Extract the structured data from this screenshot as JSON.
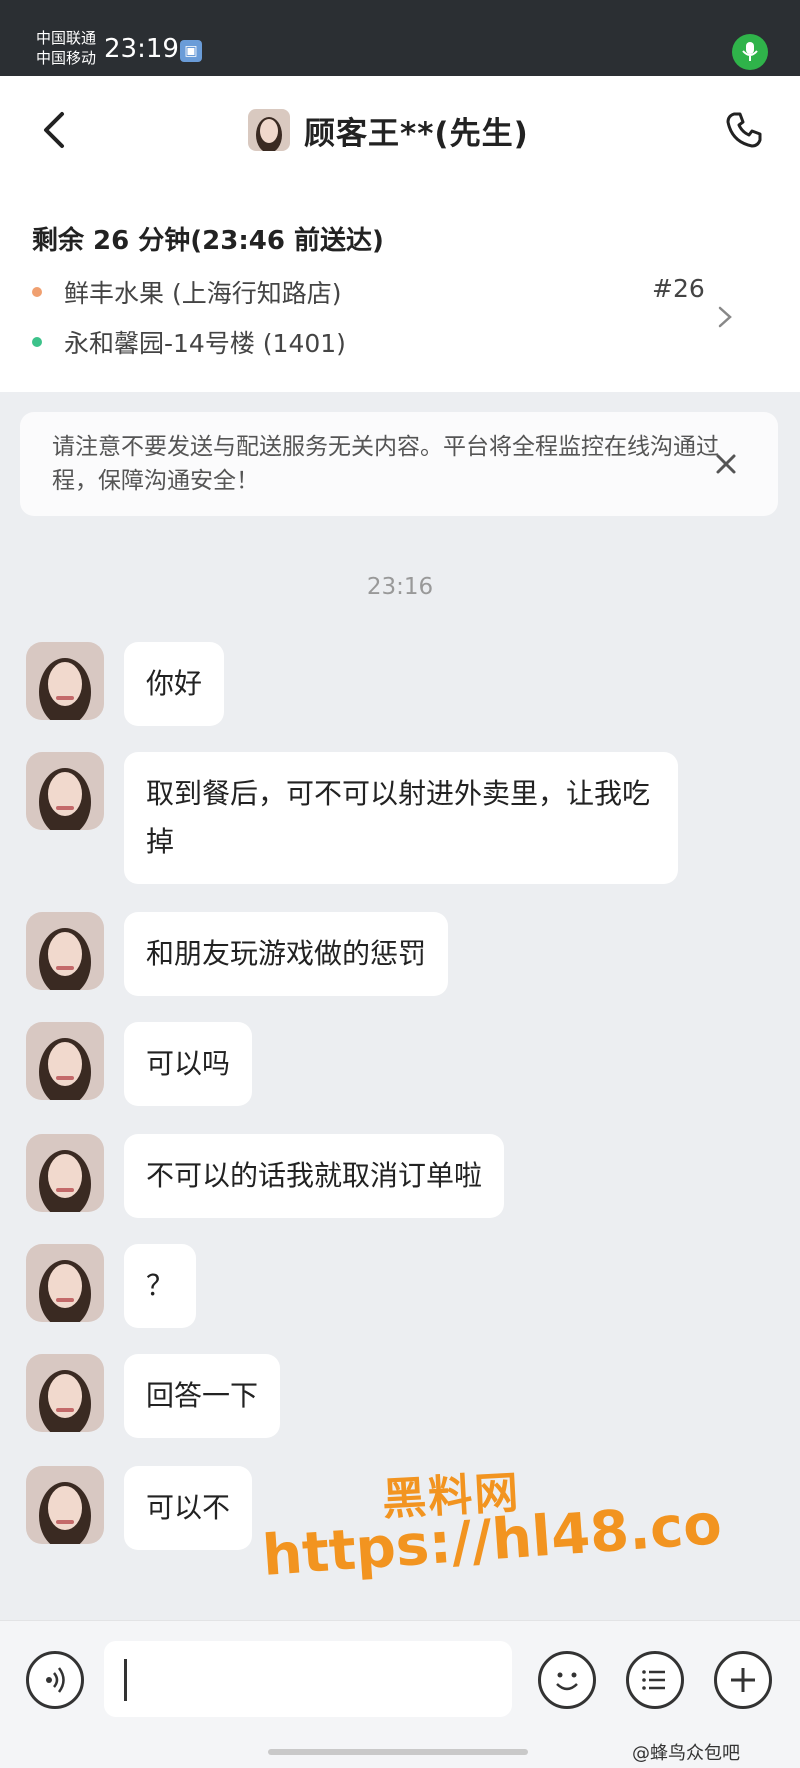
{
  "status_bar": {
    "carrier1": "中国联通",
    "carrier2": "中国移动",
    "time": "23:19",
    "sim_icon": "sim-icon",
    "mic_icon": "mic-icon"
  },
  "header": {
    "title": "顾客王**(先生)",
    "back_icon": "chevron-left-icon",
    "phone_icon": "phone-icon"
  },
  "order": {
    "remaining": "剩余 26 分钟(23:46 前送达)",
    "store": "鲜丰水果 (上海行知路店)",
    "address": "永和馨园-14号楼 (1401)",
    "order_number": "#26",
    "store_dot_color": "#f0a070",
    "address_dot_color": "#3cc28a"
  },
  "notice": {
    "text": "请注意不要发送与配送服务无关内容。平台将全程监控在线沟通过程，保障沟通安全！"
  },
  "chat": {
    "timestamp": "23:16",
    "messages": [
      {
        "text": "你好"
      },
      {
        "text": "取到餐后，可不可以射进外卖里，让我吃掉"
      },
      {
        "text": "和朋友玩游戏做的惩罚"
      },
      {
        "text": "可以吗"
      },
      {
        "text": "不可以的话我就取消订单啦"
      },
      {
        "text": "？"
      },
      {
        "text": "回答一下"
      },
      {
        "text": "可以不"
      }
    ]
  },
  "watermark": {
    "line1": "黑料网",
    "line2": "https://hl48.co"
  },
  "input_bar": {
    "input_value": "",
    "credit": "@蜂鸟众包吧",
    "icons": [
      "voice-icon",
      "emoji-icon",
      "menu-icon",
      "plus-icon"
    ]
  }
}
